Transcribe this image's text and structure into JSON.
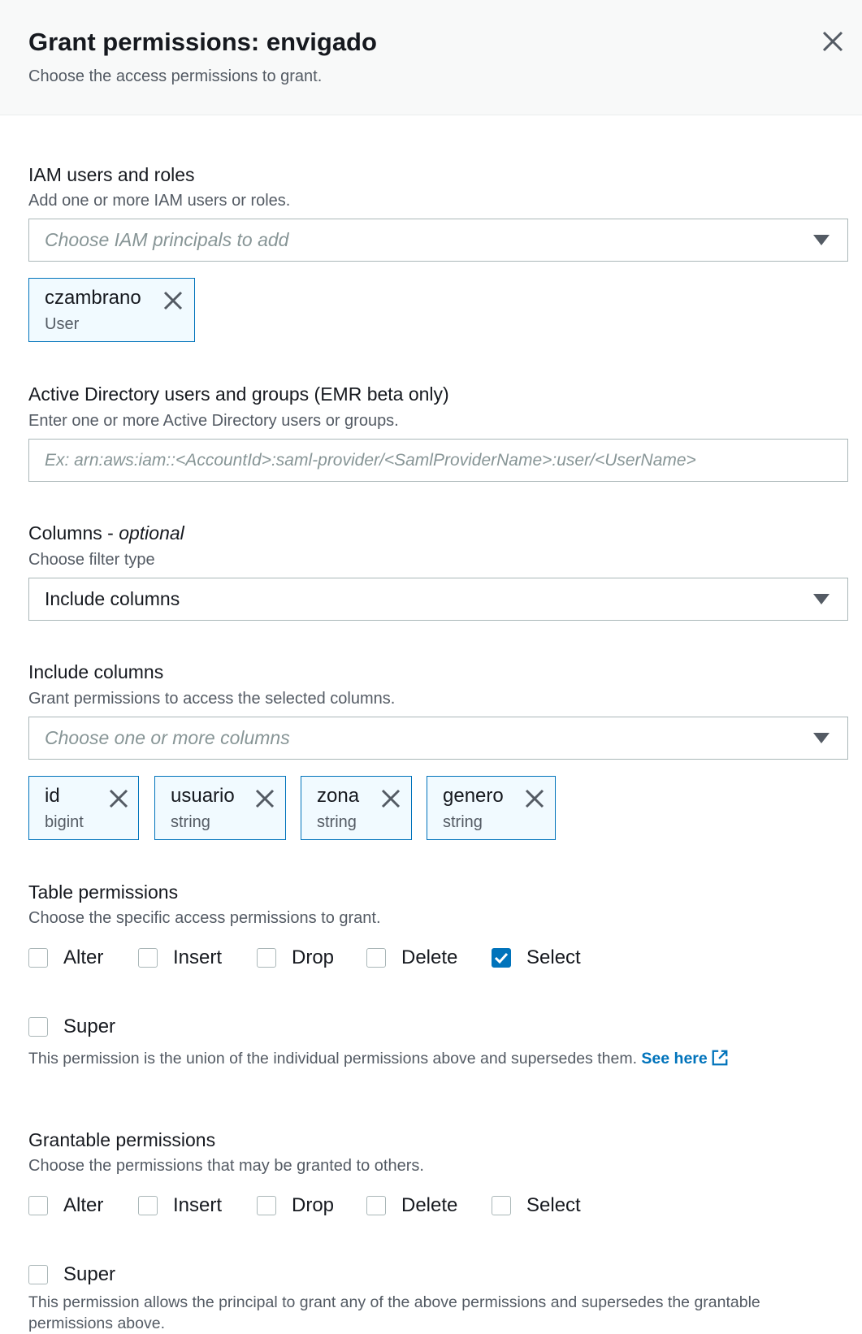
{
  "header": {
    "title": "Grant permissions: envigado",
    "subtitle": "Choose the access permissions to grant.",
    "close_icon": "close-icon"
  },
  "iam": {
    "label": "IAM users and roles",
    "description": "Add one or more IAM users or roles.",
    "placeholder": "Choose IAM principals to add",
    "tokens": [
      {
        "name": "czambrano",
        "type": "User"
      }
    ]
  },
  "ad": {
    "label": "Active Directory users and groups (EMR beta only)",
    "description": "Enter one or more Active Directory users or groups.",
    "placeholder": "Ex: arn:aws:iam::<AccountId>:saml-provider/<SamlProviderName>:user/<UserName>"
  },
  "columns": {
    "label": "Columns - ",
    "label_optional": "optional",
    "description": "Choose filter type",
    "selected": "Include columns"
  },
  "include_columns": {
    "label": "Include columns",
    "description": "Grant permissions to access the selected columns.",
    "placeholder": "Choose one or more columns",
    "tokens": [
      {
        "name": "id",
        "type": "bigint"
      },
      {
        "name": "usuario",
        "type": "string"
      },
      {
        "name": "zona",
        "type": "string"
      },
      {
        "name": "genero",
        "type": "string"
      }
    ]
  },
  "table_permissions": {
    "label": "Table permissions",
    "description": "Choose the specific access permissions to grant.",
    "options": [
      {
        "label": "Alter",
        "checked": false
      },
      {
        "label": "Insert",
        "checked": false
      },
      {
        "label": "Drop",
        "checked": false
      },
      {
        "label": "Delete",
        "checked": false
      },
      {
        "label": "Select",
        "checked": true
      }
    ],
    "super": {
      "label": "Super",
      "checked": false
    },
    "super_note": "This permission is the union of the individual permissions above and supersedes them.",
    "see_here": "See here"
  },
  "grantable_permissions": {
    "label": "Grantable permissions",
    "description": "Choose the permissions that may be granted to others.",
    "options": [
      {
        "label": "Alter",
        "checked": false
      },
      {
        "label": "Insert",
        "checked": false
      },
      {
        "label": "Drop",
        "checked": false
      },
      {
        "label": "Delete",
        "checked": false
      },
      {
        "label": "Select",
        "checked": false
      }
    ],
    "super": {
      "label": "Super",
      "checked": false
    },
    "super_note": "This permission allows the principal to grant any of the above permissions and supersedes the grantable permissions above."
  },
  "colors": {
    "accent": "#0073bb",
    "token_bg": "#f1faff",
    "border": "#aab7b8"
  }
}
